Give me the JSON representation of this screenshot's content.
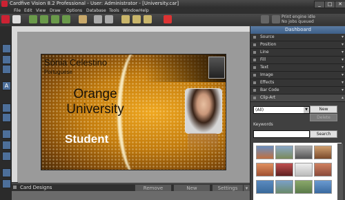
{
  "window": {
    "title": "Cardfive Vision 8.2 Professional - User: Administrator - [University.car]"
  },
  "window_buttons": {
    "minimize": "_",
    "maximize": "□",
    "close": "✕"
  },
  "menu": [
    "File",
    "Edit",
    "View",
    "Draw",
    "Options",
    "Database",
    "Tools",
    "Window",
    "Help"
  ],
  "print_status": {
    "line1": "Print engine idle",
    "line2": "No jobs queued"
  },
  "card": {
    "name": "Sónia Celestino",
    "nationality": "Portuguese",
    "university_line1": "Orange",
    "university_line2": "University",
    "role": "Student"
  },
  "bottom": {
    "label": "Card Designs",
    "remove": "Remove",
    "new": "New",
    "settings": "Settings"
  },
  "dashboard": {
    "title": "Dashboard",
    "sections": [
      "Source",
      "Position",
      "Line",
      "Fill",
      "Text",
      "Image",
      "Effects",
      "Bar Code",
      "Clip-Art"
    ],
    "clipart": {
      "category": "(All)",
      "new_label": "New",
      "delete_label": "Delete",
      "keywords_label": "Keywords",
      "search_label": "Search"
    }
  },
  "colors": {
    "accent": "#4a6c96",
    "card_gold": "#e09a18"
  }
}
